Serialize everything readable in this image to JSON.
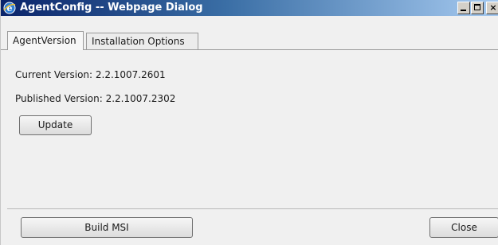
{
  "window": {
    "title": "AgentConfig -- Webpage Dialog",
    "icon": "ie-icon",
    "caption_buttons": {
      "minimize": "minimize",
      "maximize": "maximize",
      "close": "×"
    }
  },
  "tabs": [
    {
      "label": "AgentVersion",
      "active": true
    },
    {
      "label": "Installation Options",
      "active": false
    }
  ],
  "version_panel": {
    "current_version": "Current Version: 2.2.1007.2601",
    "published_version": "Published Version: 2.2.1007.2302",
    "update_label": "Update"
  },
  "footer": {
    "build_msi_label": "Build MSI",
    "close_label": "Close"
  },
  "colors": {
    "titlebar_start": "#0a246a",
    "titlebar_end": "#a6caf0",
    "dialog_background": "#f0f0f0"
  }
}
